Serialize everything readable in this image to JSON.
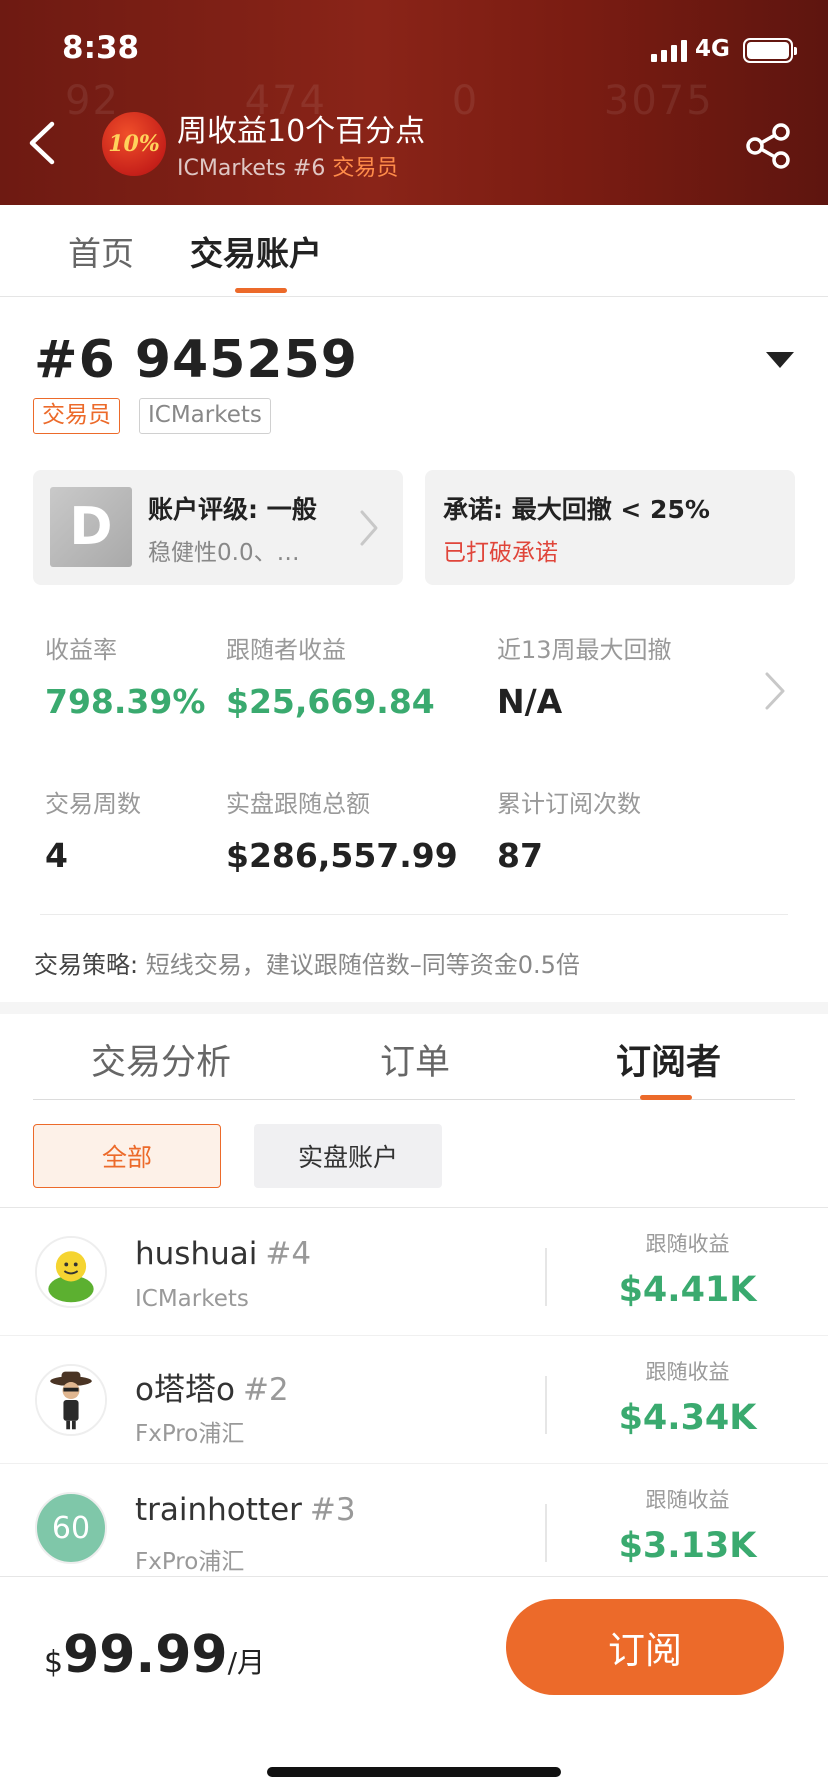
{
  "status_bar": {
    "time": "8:38",
    "network": "4G"
  },
  "header": {
    "background_numbers": [
      "92",
      "474",
      "0",
      "3075"
    ],
    "avatar_text": "10%",
    "title": "周收益10个百分点",
    "subtitle_prefix": "ICMarkets #6 ",
    "subtitle_role": "交易员"
  },
  "main_tabs": [
    {
      "label": "首页",
      "active": false
    },
    {
      "label": "交易账户",
      "active": true
    }
  ],
  "account": {
    "id": "#6 945259",
    "role_tag": "交易员",
    "broker_tag": "ICMarkets"
  },
  "rating_card": {
    "grade": "D",
    "title": "账户评级: 一般",
    "desc": "稳健性0.0、…"
  },
  "promise_card": {
    "title": "承诺: 最大回撤 < 25%",
    "status": "已打破承诺"
  },
  "stats": {
    "return_label": "收益率",
    "return_value": "798.39%",
    "follower_profit_label": "跟随者收益",
    "follower_profit_value": "$25,669.84",
    "max_drawdown_label": "近13周最大回撤",
    "max_drawdown_value": "N/A",
    "weeks_label": "交易周数",
    "weeks_value": "4",
    "total_follow_label": "实盘跟随总额",
    "total_follow_value": "$286,557.99",
    "subs_label": "累计订阅次数",
    "subs_value": "87"
  },
  "strategy": {
    "key": "交易策略:",
    "text": " 短线交易，建议跟随倍数–同等资金0.5倍"
  },
  "sub_tabs": [
    {
      "label": "交易分析",
      "active": false
    },
    {
      "label": "订单",
      "active": false
    },
    {
      "label": "订阅者",
      "active": true
    }
  ],
  "filters": {
    "all": "全部",
    "real": "实盘账户"
  },
  "subscribers": [
    {
      "name": "hushuai",
      "rank": "#4",
      "broker": "ICMarkets",
      "profit_label": "跟随收益",
      "profit": "$4.41K",
      "avatar": "smiley-avatar"
    },
    {
      "name": "o塔塔o",
      "rank": "#2",
      "broker": "FxPro浦汇",
      "profit_label": "跟随收益",
      "profit": "$4.34K",
      "avatar": "cowboy-avatar"
    },
    {
      "name": "trainhotter",
      "rank": "#3",
      "broker": "FxPro浦汇",
      "profit_label": "跟随收益",
      "profit": "$3.13K",
      "avatar_text": "60"
    }
  ],
  "bottom": {
    "currency": "$",
    "price": "99.99",
    "unit": "/月",
    "subscribe_label": "订阅"
  },
  "colors": {
    "accent": "#ec6a2a",
    "positive": "#3aaa6f",
    "warning": "#e0453a",
    "header_bg": "#7a1c12"
  }
}
